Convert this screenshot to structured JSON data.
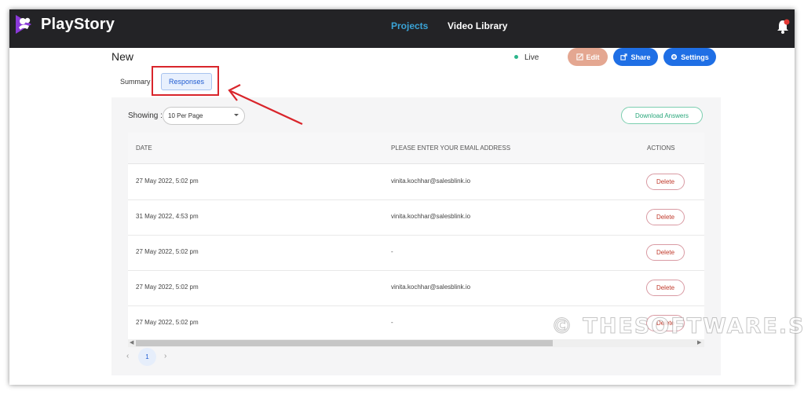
{
  "header": {
    "brand": "PlayStory",
    "nav": [
      {
        "label": "Projects",
        "active": true
      },
      {
        "label": "Video Library",
        "active": false
      }
    ],
    "bell_icon": "bell-icon",
    "accent_color": "#3aa3d6"
  },
  "page": {
    "title": "New",
    "status": "Live",
    "actions": {
      "edit_label": "Edit",
      "share_label": "Share",
      "settings_label": "Settings"
    },
    "tabs": [
      {
        "label": "Summary",
        "active": false
      },
      {
        "label": "Responses",
        "active": true
      }
    ]
  },
  "controls": {
    "showing_label": "Showing :",
    "per_page_value": "10 Per Page",
    "download_label": "Download Answers"
  },
  "table": {
    "columns": [
      "DATE",
      "PLEASE ENTER YOUR EMAIL ADDRESS",
      "ACTIONS"
    ],
    "rows": [
      {
        "date": "27 May 2022, 5:02 pm",
        "email": "vinita.kochhar@salesblink.io",
        "action": "Delete"
      },
      {
        "date": "31 May 2022, 4:53 pm",
        "email": "vinita.kochhar@salesblink.io",
        "action": "Delete"
      },
      {
        "date": "27 May 2022, 5:02 pm",
        "email": "-",
        "action": "Delete"
      },
      {
        "date": "27 May 2022, 5:02 pm",
        "email": "vinita.kochhar@salesblink.io",
        "action": "Delete"
      },
      {
        "date": "27 May 2022, 5:02 pm",
        "email": "-",
        "action": "Delete"
      }
    ]
  },
  "pagination": {
    "prev": "‹",
    "current": "1",
    "next": "›"
  },
  "watermark": "© THESOFTWARE.SH"
}
